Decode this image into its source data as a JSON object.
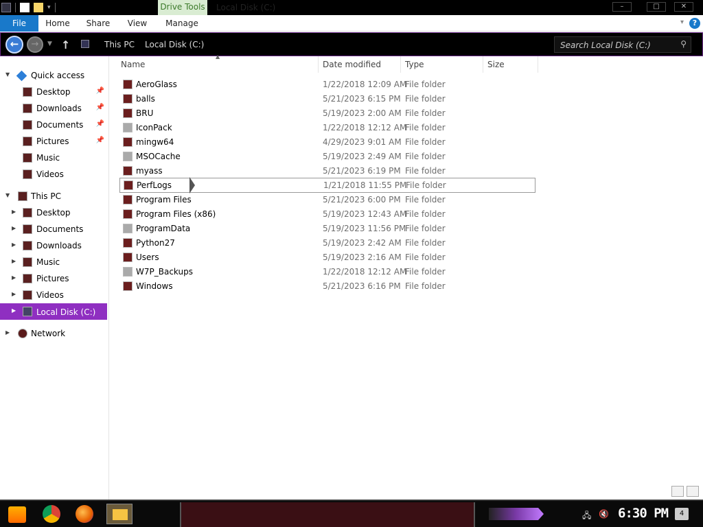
{
  "titlebar": {
    "drive_tools": "Drive Tools",
    "window_title": "Local Disk (C:)",
    "minimize": "–",
    "maximize": "□",
    "close": "✕"
  },
  "ribbon": {
    "tabs": [
      "File",
      "Home",
      "Share",
      "View",
      "Manage"
    ],
    "help": "?"
  },
  "address": {
    "crumbs": [
      "This PC",
      "Local Disk (C:)"
    ],
    "search_placeholder": "Search Local Disk (C:)"
  },
  "sidebar": {
    "quick_access": "Quick access",
    "quick_items": [
      "Desktop",
      "Downloads",
      "Documents",
      "Pictures",
      "Music",
      "Videos"
    ],
    "this_pc": "This PC",
    "pc_items": [
      "Desktop",
      "Documents",
      "Downloads",
      "Music",
      "Pictures",
      "Videos"
    ],
    "local_disk": "Local Disk (C:)",
    "network": "Network"
  },
  "columns": {
    "name": "Name",
    "date_modified": "Date modified",
    "type": "Type",
    "size": "Size"
  },
  "files": [
    {
      "name": "AeroGlass",
      "date": "1/22/2018 12:09 AM",
      "type": "File folder"
    },
    {
      "name": "balls",
      "date": "5/21/2023 6:15 PM",
      "type": "File folder"
    },
    {
      "name": "BRU",
      "date": "5/19/2023 2:00 AM",
      "type": "File folder"
    },
    {
      "name": "IconPack",
      "date": "1/22/2018 12:12 AM",
      "type": "File folder"
    },
    {
      "name": "mingw64",
      "date": "4/29/2023 9:01 AM",
      "type": "File folder"
    },
    {
      "name": "MSOCache",
      "date": "5/19/2023 2:49 AM",
      "type": "File folder"
    },
    {
      "name": "myass",
      "date": "5/21/2023 6:19 PM",
      "type": "File folder"
    },
    {
      "name": "PerfLogs",
      "date": "1/21/2018 11:55 PM",
      "type": "File folder"
    },
    {
      "name": "Program Files",
      "date": "5/21/2023 6:00 PM",
      "type": "File folder"
    },
    {
      "name": "Program Files (x86)",
      "date": "5/19/2023 12:43 AM",
      "type": "File folder"
    },
    {
      "name": "ProgramData",
      "date": "5/19/2023 11:56 PM",
      "type": "File folder"
    },
    {
      "name": "Python27",
      "date": "5/19/2023 2:42 AM",
      "type": "File folder"
    },
    {
      "name": "Users",
      "date": "5/19/2023 2:16 AM",
      "type": "File folder"
    },
    {
      "name": "W7P_Backups",
      "date": "1/22/2018 12:12 AM",
      "type": "File folder"
    },
    {
      "name": "Windows",
      "date": "5/21/2023 6:16 PM",
      "type": "File folder"
    }
  ],
  "taskbar": {
    "clock": "6:30 PM",
    "notification_count": "4"
  }
}
